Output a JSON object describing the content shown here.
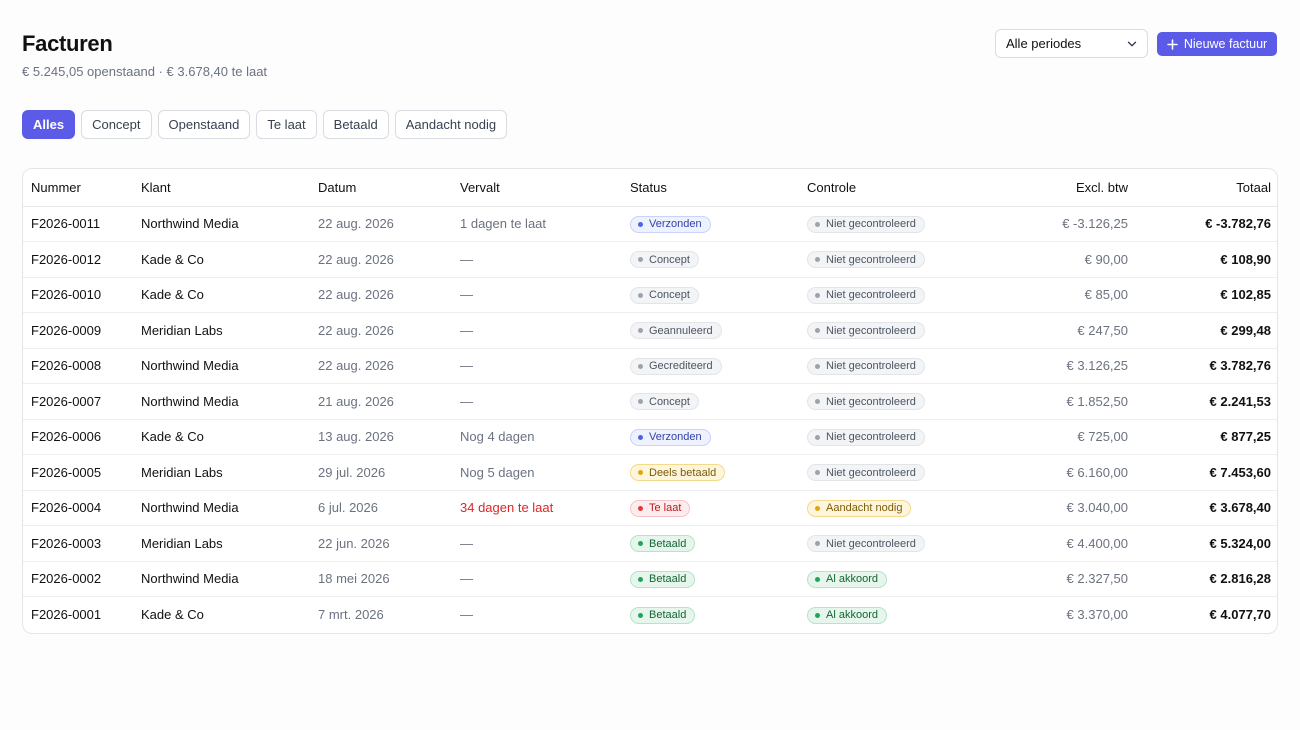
{
  "header": {
    "title": "Facturen",
    "subtitle": "€ 5.245,05 openstaand · € 3.678,40 te laat",
    "period_select": "Alle periodes",
    "new_button": "Nieuwe factuur"
  },
  "tabs": [
    {
      "label": "Alles",
      "active": true
    },
    {
      "label": "Concept",
      "active": false
    },
    {
      "label": "Openstaand",
      "active": false
    },
    {
      "label": "Te laat",
      "active": false
    },
    {
      "label": "Betaald",
      "active": false
    },
    {
      "label": "Aandacht nodig",
      "active": false
    }
  ],
  "table": {
    "columns": [
      "Nummer",
      "Klant",
      "Datum",
      "Vervalt",
      "Status",
      "Controle",
      "Excl. btw",
      "Totaal"
    ],
    "rows": [
      {
        "nummer": "F2026-0011",
        "klant": "Northwind Media",
        "datum": "22 aug. 2026",
        "vervalt": "1 dagen te laat",
        "vervalt_late": false,
        "status": "Verzonden",
        "status_color": "blue",
        "controle": "Niet gecontroleerd",
        "controle_color": "gray",
        "excl": "€ -3.126,25",
        "totaal": "€ -3.782,76"
      },
      {
        "nummer": "F2026-0012",
        "klant": "Kade & Co",
        "datum": "22 aug. 2026",
        "vervalt": "—",
        "vervalt_late": false,
        "status": "Concept",
        "status_color": "gray",
        "controle": "Niet gecontroleerd",
        "controle_color": "gray",
        "excl": "€ 90,00",
        "totaal": "€ 108,90"
      },
      {
        "nummer": "F2026-0010",
        "klant": "Kade & Co",
        "datum": "22 aug. 2026",
        "vervalt": "—",
        "vervalt_late": false,
        "status": "Concept",
        "status_color": "gray",
        "controle": "Niet gecontroleerd",
        "controle_color": "gray",
        "excl": "€ 85,00",
        "totaal": "€ 102,85"
      },
      {
        "nummer": "F2026-0009",
        "klant": "Meridian Labs",
        "datum": "22 aug. 2026",
        "vervalt": "—",
        "vervalt_late": false,
        "status": "Geannuleerd",
        "status_color": "gray",
        "controle": "Niet gecontroleerd",
        "controle_color": "gray",
        "excl": "€ 247,50",
        "totaal": "€ 299,48"
      },
      {
        "nummer": "F2026-0008",
        "klant": "Northwind Media",
        "datum": "22 aug. 2026",
        "vervalt": "—",
        "vervalt_late": false,
        "status": "Gecrediteerd",
        "status_color": "gray",
        "controle": "Niet gecontroleerd",
        "controle_color": "gray",
        "excl": "€ 3.126,25",
        "totaal": "€ 3.782,76"
      },
      {
        "nummer": "F2026-0007",
        "klant": "Northwind Media",
        "datum": "21 aug. 2026",
        "vervalt": "—",
        "vervalt_late": false,
        "status": "Concept",
        "status_color": "gray",
        "controle": "Niet gecontroleerd",
        "controle_color": "gray",
        "excl": "€ 1.852,50",
        "totaal": "€ 2.241,53"
      },
      {
        "nummer": "F2026-0006",
        "klant": "Kade & Co",
        "datum": "13 aug. 2026",
        "vervalt": "Nog 4 dagen",
        "vervalt_late": false,
        "status": "Verzonden",
        "status_color": "blue",
        "controle": "Niet gecontroleerd",
        "controle_color": "gray",
        "excl": "€ 725,00",
        "totaal": "€ 877,25"
      },
      {
        "nummer": "F2026-0005",
        "klant": "Meridian Labs",
        "datum": "29 jul. 2026",
        "vervalt": "Nog 5 dagen",
        "vervalt_late": false,
        "status": "Deels betaald",
        "status_color": "yellow",
        "controle": "Niet gecontroleerd",
        "controle_color": "gray",
        "excl": "€ 6.160,00",
        "totaal": "€ 7.453,60"
      },
      {
        "nummer": "F2026-0004",
        "klant": "Northwind Media",
        "datum": "6 jul. 2026",
        "vervalt": "34 dagen te laat",
        "vervalt_late": true,
        "status": "Te laat",
        "status_color": "red",
        "controle": "Aandacht nodig",
        "controle_color": "yellow",
        "excl": "€ 3.040,00",
        "totaal": "€ 3.678,40"
      },
      {
        "nummer": "F2026-0003",
        "klant": "Meridian Labs",
        "datum": "22 jun. 2026",
        "vervalt": "—",
        "vervalt_late": false,
        "status": "Betaald",
        "status_color": "green",
        "controle": "Niet gecontroleerd",
        "controle_color": "gray",
        "excl": "€ 4.400,00",
        "totaal": "€ 5.324,00"
      },
      {
        "nummer": "F2026-0002",
        "klant": "Northwind Media",
        "datum": "18 mei 2026",
        "vervalt": "—",
        "vervalt_late": false,
        "status": "Betaald",
        "status_color": "green",
        "controle": "Al akkoord",
        "controle_color": "green",
        "excl": "€ 2.327,50",
        "totaal": "€ 2.816,28"
      },
      {
        "nummer": "F2026-0001",
        "klant": "Kade & Co",
        "datum": "7 mrt. 2026",
        "vervalt": "—",
        "vervalt_late": false,
        "status": "Betaald",
        "status_color": "green",
        "controle": "Al akkoord",
        "controle_color": "green",
        "excl": "€ 3.370,00",
        "totaal": "€ 4.077,70"
      }
    ]
  },
  "colors": {
    "accent": "#5b5be8",
    "late_text": "#dc2626"
  }
}
